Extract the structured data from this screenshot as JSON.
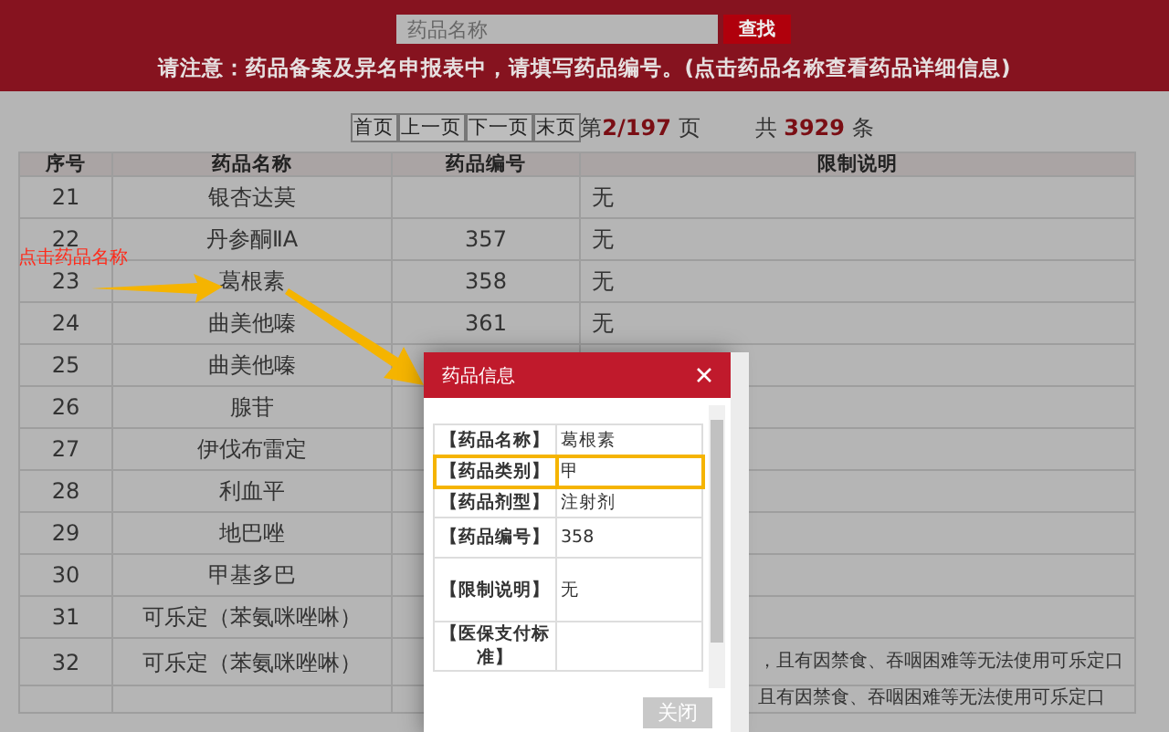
{
  "search": {
    "placeholder": "药品名称",
    "button": "查找"
  },
  "notice": "请注意：药品备案及异名申报表中，请填写药品编号。(点击药品名称查看药品详细信息)",
  "pagination": {
    "buttons": [
      "首页",
      "上一页",
      "下一页",
      "末页"
    ],
    "page_prefix": "第",
    "page": "2/197",
    "page_suffix": "页",
    "total_prefix": "共",
    "total": "3929",
    "total_suffix": "条"
  },
  "table": {
    "columns": [
      "序号",
      "药品名称",
      "药品编号",
      "限制说明"
    ],
    "rows": [
      {
        "no": "21",
        "name": "银杏达莫",
        "note": "无"
      },
      {
        "no": "22",
        "name": "丹参酮ⅡA",
        "code": "357",
        "note": "无"
      },
      {
        "no": "23",
        "name": "葛根素",
        "code": "358",
        "note": "无"
      },
      {
        "no": "24",
        "name": "曲美他嗪",
        "code": "361",
        "note": "无"
      },
      {
        "no": "25",
        "name": "曲美他嗪"
      },
      {
        "no": "26",
        "name": "腺苷"
      },
      {
        "no": "27",
        "name": "伊伐布雷定"
      },
      {
        "no": "28",
        "name": "利血平"
      },
      {
        "no": "29",
        "name": "地巴唑"
      },
      {
        "no": "30",
        "name": "甲基多巴"
      },
      {
        "no": "31",
        "name": "可乐定（苯氨咪唑啉）"
      },
      {
        "no": "32",
        "name": "可乐定（苯氨咪唑啉）",
        "note": "，且有因禁食、吞咽困难等无法使用可乐定口",
        "kind": "continued"
      },
      {
        "note": "且有因禁食、吞咽困难等无法使用可乐定口",
        "kind": "continued"
      }
    ]
  },
  "annotation": {
    "text": "点击药品名称"
  },
  "dialog": {
    "title": "药品信息",
    "fields": [
      {
        "label": "【药品名称】",
        "value": "葛根素",
        "highlighted": false
      },
      {
        "label": "【药品类别】",
        "value": "甲",
        "highlighted": true
      },
      {
        "label": "【药品剂型】",
        "value": "注射剂",
        "highlighted": false
      },
      {
        "label": "【药品编号】",
        "value": "358",
        "highlighted": false
      },
      {
        "label": "【限制说明】",
        "value": "无",
        "highlighted": false
      },
      {
        "label": "【医保支付标准】",
        "highlighted": false
      }
    ],
    "button": "关闭"
  }
}
